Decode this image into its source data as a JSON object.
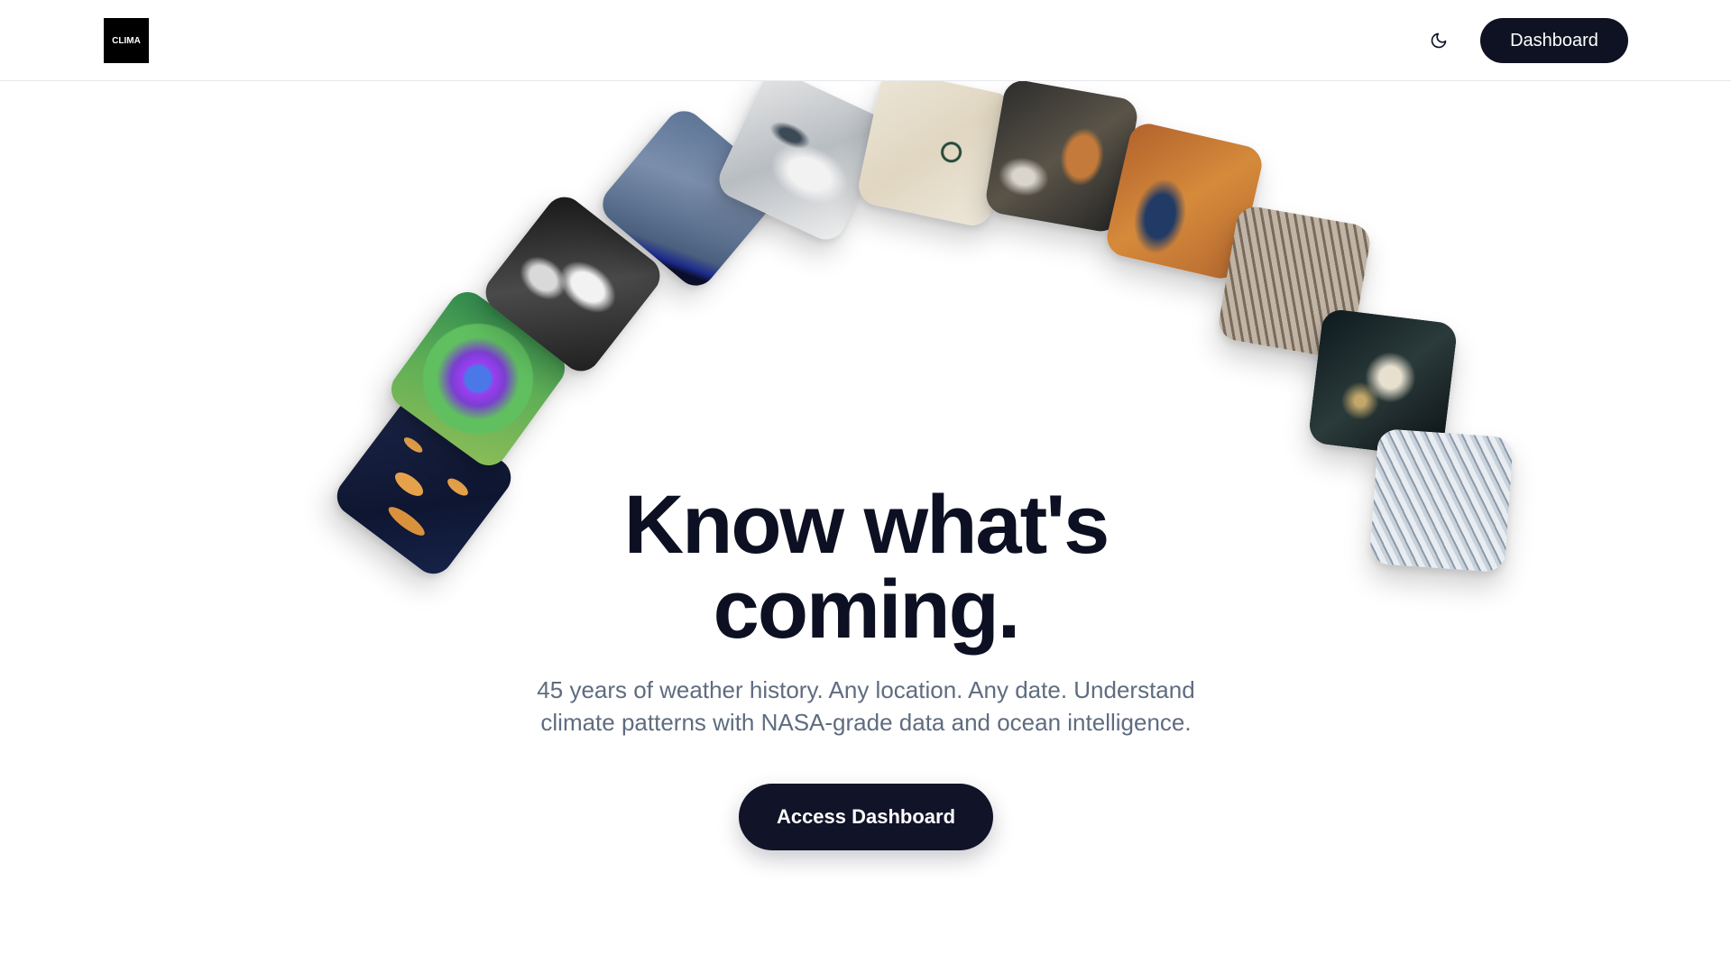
{
  "header": {
    "logo_text": "CLIMA",
    "theme_toggle_icon": "moon-icon",
    "nav_button_label": "Dashboard"
  },
  "hero": {
    "headline_line1": "Know what's",
    "headline_line2": "coming.",
    "subtext_line1": "45 years of weather history. Any location. Any date. Understand",
    "subtext_line2": "climate patterns with NASA-grade data and ocean intelligence.",
    "cta_label": "Access Dashboard"
  },
  "colors": {
    "primary_dark": "#0f1222",
    "headline": "#0c1022",
    "subtext": "#5f6c80",
    "background": "#ffffff"
  }
}
